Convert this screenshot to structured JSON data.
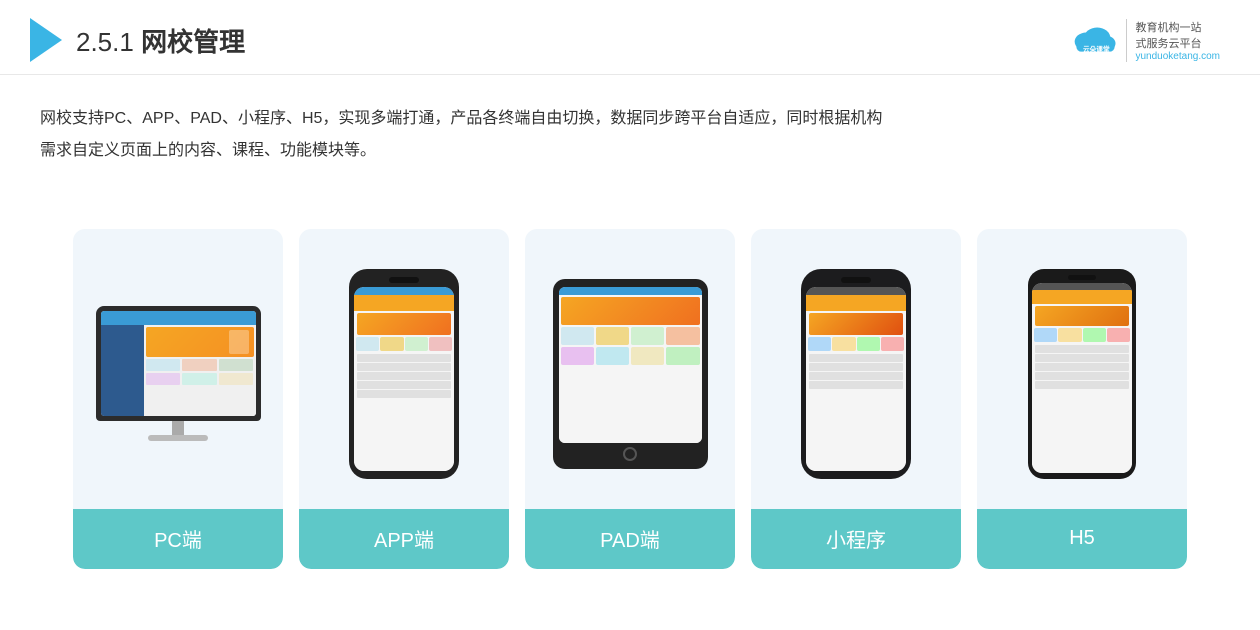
{
  "header": {
    "section_number": "2.5.1",
    "title_plain": "",
    "title_bold": "网校管理",
    "logo_site": "yunduoketang.com",
    "logo_slogan_top": "教育机构一站",
    "logo_slogan_bottom": "式服务云平台"
  },
  "description": {
    "line1": "网校支持PC、APP、PAD、小程序、H5，实现多端打通，产品各终端自由切换，数据同步跨平台自适应，同时根据机构",
    "line2": "需求自定义页面上的内容、课程、功能模块等。"
  },
  "cards": [
    {
      "id": "pc",
      "label": "PC端",
      "label_color": "#5ec8c0"
    },
    {
      "id": "app",
      "label": "APP端",
      "label_color": "#5ec8c0"
    },
    {
      "id": "pad",
      "label": "PAD端",
      "label_color": "#5ec8c0"
    },
    {
      "id": "miniapp",
      "label": "小程序",
      "label_color": "#5ec8c0"
    },
    {
      "id": "h5",
      "label": "H5",
      "label_color": "#5ec8c0"
    }
  ]
}
